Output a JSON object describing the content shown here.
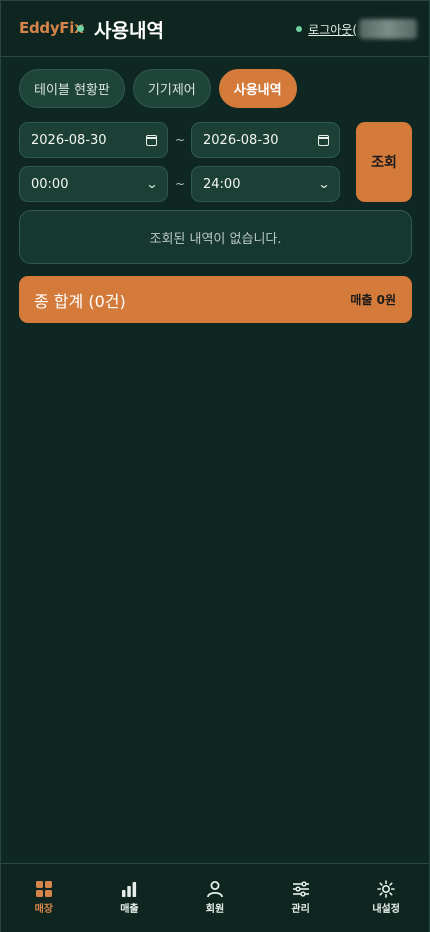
{
  "header": {
    "brand": "EddyFix",
    "title": "사용내역",
    "logout_label": "로그아웃("
  },
  "tabs": [
    {
      "label": "테이블 현황판",
      "active": false
    },
    {
      "label": "기기제어",
      "active": false
    },
    {
      "label": "사용내역",
      "active": true
    }
  ],
  "filter": {
    "start_date": "2026-08-30",
    "end_date": "2026-08-30",
    "start_time": "00:00",
    "end_time": "24:00",
    "separator": "~",
    "search_label": "조회"
  },
  "results": {
    "empty_message": "조회된 내역이 없습니다."
  },
  "summary": {
    "total_label": "종 합계 (0건)",
    "sales_label": "매출 0원"
  },
  "bottom_nav": [
    {
      "label": "매장",
      "icon": "grid-icon",
      "active": true
    },
    {
      "label": "매출",
      "icon": "bar-chart-icon",
      "active": false
    },
    {
      "label": "회원",
      "icon": "person-icon",
      "active": false
    },
    {
      "label": "관리",
      "icon": "sliders-icon",
      "active": false
    },
    {
      "label": "내설정",
      "icon": "gear-icon",
      "active": false
    }
  ],
  "colors": {
    "background": "#0f2722",
    "accent": "#d47b3b",
    "status_dot": "#6fd1a3"
  }
}
